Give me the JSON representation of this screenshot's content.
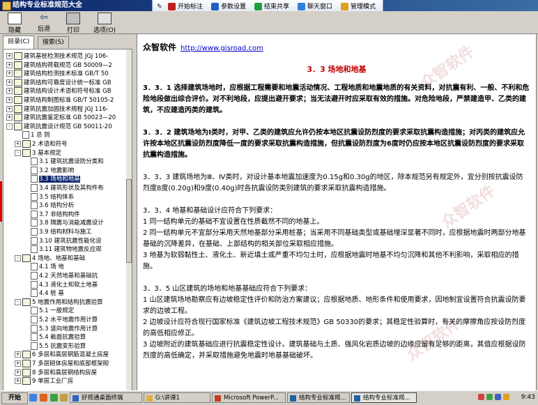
{
  "window": {
    "title": "结构专业标准规范大全"
  },
  "floatbar": [
    {
      "label": "开始标注",
      "color": "#c02020"
    },
    {
      "label": "参数设置",
      "color": "#2060c0"
    },
    {
      "label": "结束共享",
      "color": "#20a040"
    },
    {
      "label": "聊天窗口",
      "color": "#3080e0"
    },
    {
      "label": "管理模式",
      "color": "#e0a020"
    }
  ],
  "toolbar": {
    "hide": "隐藏",
    "back": "后退",
    "print": "打印",
    "options": "选项(O)"
  },
  "tabs": {
    "contents": "目录(C)",
    "search": "搜索(S)"
  },
  "tree": [
    {
      "label": "建筑基桩检测技术规范 JGJ 106-",
      "level": 0,
      "type": "book",
      "pm": "+"
    },
    {
      "label": "建筑结构荷载规范 GB 50009—2",
      "level": 0,
      "type": "book",
      "pm": "+"
    },
    {
      "label": "建筑结构检测技术标准 GB/T 50",
      "level": 0,
      "type": "book",
      "pm": "+"
    },
    {
      "label": "建筑结构可靠度设计统一标准 GB",
      "level": 0,
      "type": "book",
      "pm": "+"
    },
    {
      "label": "建筑结构设计术语和符号标准 GB",
      "level": 0,
      "type": "book",
      "pm": "+"
    },
    {
      "label": "建筑结构制图标准 GB/T 50105-2",
      "level": 0,
      "type": "book",
      "pm": "+"
    },
    {
      "label": "建筑抗震加固技术规程 JGJ 116-",
      "level": 0,
      "type": "book",
      "pm": "+"
    },
    {
      "label": "建筑抗震鉴定标准 GB 50023—20",
      "level": 0,
      "type": "book",
      "pm": "+"
    },
    {
      "label": "建筑抗震设计规范 GB 50011-20",
      "level": 0,
      "type": "book",
      "pm": "-"
    },
    {
      "label": "1 总 则",
      "level": 1,
      "type": "page",
      "pm": ""
    },
    {
      "label": "2 术语和符号",
      "level": 1,
      "type": "book",
      "pm": "+"
    },
    {
      "label": "3 基本规定",
      "level": 1,
      "type": "book",
      "pm": "-"
    },
    {
      "label": "3.1 建筑抗震设防分类和",
      "level": 2,
      "type": "page",
      "pm": ""
    },
    {
      "label": "3.2 地震影响",
      "level": 2,
      "type": "page",
      "pm": ""
    },
    {
      "label": "3.3 场地和地基",
      "level": 2,
      "type": "page",
      "pm": "",
      "selected": true
    },
    {
      "label": "3.4 建筑形状及其构件布",
      "level": 2,
      "type": "page",
      "pm": ""
    },
    {
      "label": "3.5 结构体系",
      "level": 2,
      "type": "page",
      "pm": ""
    },
    {
      "label": "3.6 结构分析",
      "level": 2,
      "type": "page",
      "pm": ""
    },
    {
      "label": "3.7 非结构构件",
      "level": 2,
      "type": "page",
      "pm": ""
    },
    {
      "label": "3.8 隔震与消能减震设计",
      "level": 2,
      "type": "page",
      "pm": ""
    },
    {
      "label": "3.9 结构材料与施工",
      "level": 2,
      "type": "page",
      "pm": ""
    },
    {
      "label": "3.10 建筑抗震性能化设",
      "level": 2,
      "type": "page",
      "pm": ""
    },
    {
      "label": "3.11 建筑物地震反应观",
      "level": 2,
      "type": "page",
      "pm": ""
    },
    {
      "label": "4 场地、地基和基础",
      "level": 1,
      "type": "book",
      "pm": "-"
    },
    {
      "label": "4.1 场 地",
      "level": 2,
      "type": "page",
      "pm": ""
    },
    {
      "label": "4.2 天然地基和基础抗",
      "level": 2,
      "type": "page",
      "pm": ""
    },
    {
      "label": "4.3 液化土和软土地基",
      "level": 2,
      "type": "page",
      "pm": ""
    },
    {
      "label": "4.4 桩 基",
      "level": 2,
      "type": "page",
      "pm": ""
    },
    {
      "label": "5 地震作用和结构抗震验算",
      "level": 1,
      "type": "book",
      "pm": "-"
    },
    {
      "label": "5.1 一般规定",
      "level": 2,
      "type": "page",
      "pm": ""
    },
    {
      "label": "5.2 水平地震作用计算",
      "level": 2,
      "type": "page",
      "pm": ""
    },
    {
      "label": "5.3 竖向地震作用计算",
      "level": 2,
      "type": "page",
      "pm": ""
    },
    {
      "label": "5.4 截面抗震验算",
      "level": 2,
      "type": "page",
      "pm": ""
    },
    {
      "label": "5.5 抗震变形验算",
      "level": 2,
      "type": "page",
      "pm": ""
    },
    {
      "label": "6 多层和高层钢筋混凝土房屋",
      "level": 1,
      "type": "book",
      "pm": "+"
    },
    {
      "label": "7 多层砌体房屋和底部框架砌",
      "level": 1,
      "type": "book",
      "pm": "+"
    },
    {
      "label": "8 多层和高层钢结构房屋",
      "level": 1,
      "type": "book",
      "pm": "+"
    },
    {
      "label": "9 单层工业厂房",
      "level": 1,
      "type": "book",
      "pm": "+"
    }
  ],
  "content": {
    "company": "众智软件",
    "url": "http://www.gisroad.com",
    "section_title": "3．3 场地和地基",
    "paragraphs": [
      {
        "text": "3．3．1 选择建筑场地时，应根据工程需要和地震活动情况、工程地质和地震地质的有关资料，对抗震有利、一般、不利和危险地段做出综合评价。对不利地段，应提出避开要求；当无法避开时应采取有效的措施。对危险地段，严禁建造甲、乙类的建筑，不应建造丙类的建筑。",
        "bold": true
      },
      {
        "text": "3．3．2 建筑场地为Ⅰ类时，对甲、乙类的建筑应允许仍按本地区抗震设防烈度的要求采取抗震构造措施；对丙类的建筑应允许按本地区抗震设防烈度降低一度的要求采取抗震构造措施，但抗震设防烈度为6度时仍应按本地区抗震设防烈度的要求采取抗震构造措施。",
        "bold": true
      },
      {
        "text": "3．3．3 建筑场地为Ⅲ、Ⅳ类时，对设计基本地震加速度为0.15g和0.30g的地区，除本规范另有规定外，宜分别按抗震设防烈度8度(0.20g)和9度(0.40g)时各抗震设防类别建筑的要求采取抗震构造措施。",
        "bold": false
      },
      {
        "text": "3．3．4 地基和基础设计应符合下列要求：",
        "bold": false
      },
      {
        "text": "1 同一结构单元的基础不宜设置在性质截然不同的地基上。",
        "bold": false
      },
      {
        "text": "2 同一结构单元不宜部分采用天然地基部分采用桩基；当采用不同基础类型或基础埋深显著不同时，应根据地震时两部分地基基础的沉降差异，在基础、上部结构的相关部位采取相应措施。",
        "bold": false
      },
      {
        "text": "3 地基为软弱黏性土、液化土、新近填土或严重不均匀土时，应根据地震时地基不均匀沉降和其他不利影响，采取相应的措施。",
        "bold": false
      },
      {
        "text": "3．3．5 山区建筑的场地和地基基础应符合下列要求：",
        "bold": false
      },
      {
        "text": "1 山区建筑场地勘察应有边坡稳定性评价和防治方案建议；应根据地质、地形条件和使用要求，因地制宜设置符合抗震设防要求的边坡工程。",
        "bold": false
      },
      {
        "text": "2 边坡设计应符合现行国家标准《建筑边坡工程技术规范》GB 50330的要求；其稳定性验算时，有关的摩擦角应按设防烈度的高低相应修正。",
        "bold": false
      },
      {
        "text": "3 边坡附近的建筑基础应进行抗震稳定性设计。建筑基础与土质、强风化岩质边坡的边缘应留有足够的距离，其值应根据设防烈度的高低确定，并采取措施避免地震时地基基础破坏。",
        "bold": false
      }
    ],
    "watermark": "众智软件"
  },
  "taskbar": {
    "start": "开始",
    "tasks": [
      {
        "label": "好视通桌面终端",
        "color": "#3060c0"
      },
      {
        "label": "G:\\讲课1",
        "color": "#e0b040"
      },
      {
        "label": "Microsoft PowerP...",
        "color": "#c04020"
      },
      {
        "label": "结构专业标准规...",
        "color": "#2060a0"
      },
      {
        "label": "结构专业标准规...",
        "color": "#2060a0",
        "active": true
      }
    ],
    "clock": "9:43"
  }
}
